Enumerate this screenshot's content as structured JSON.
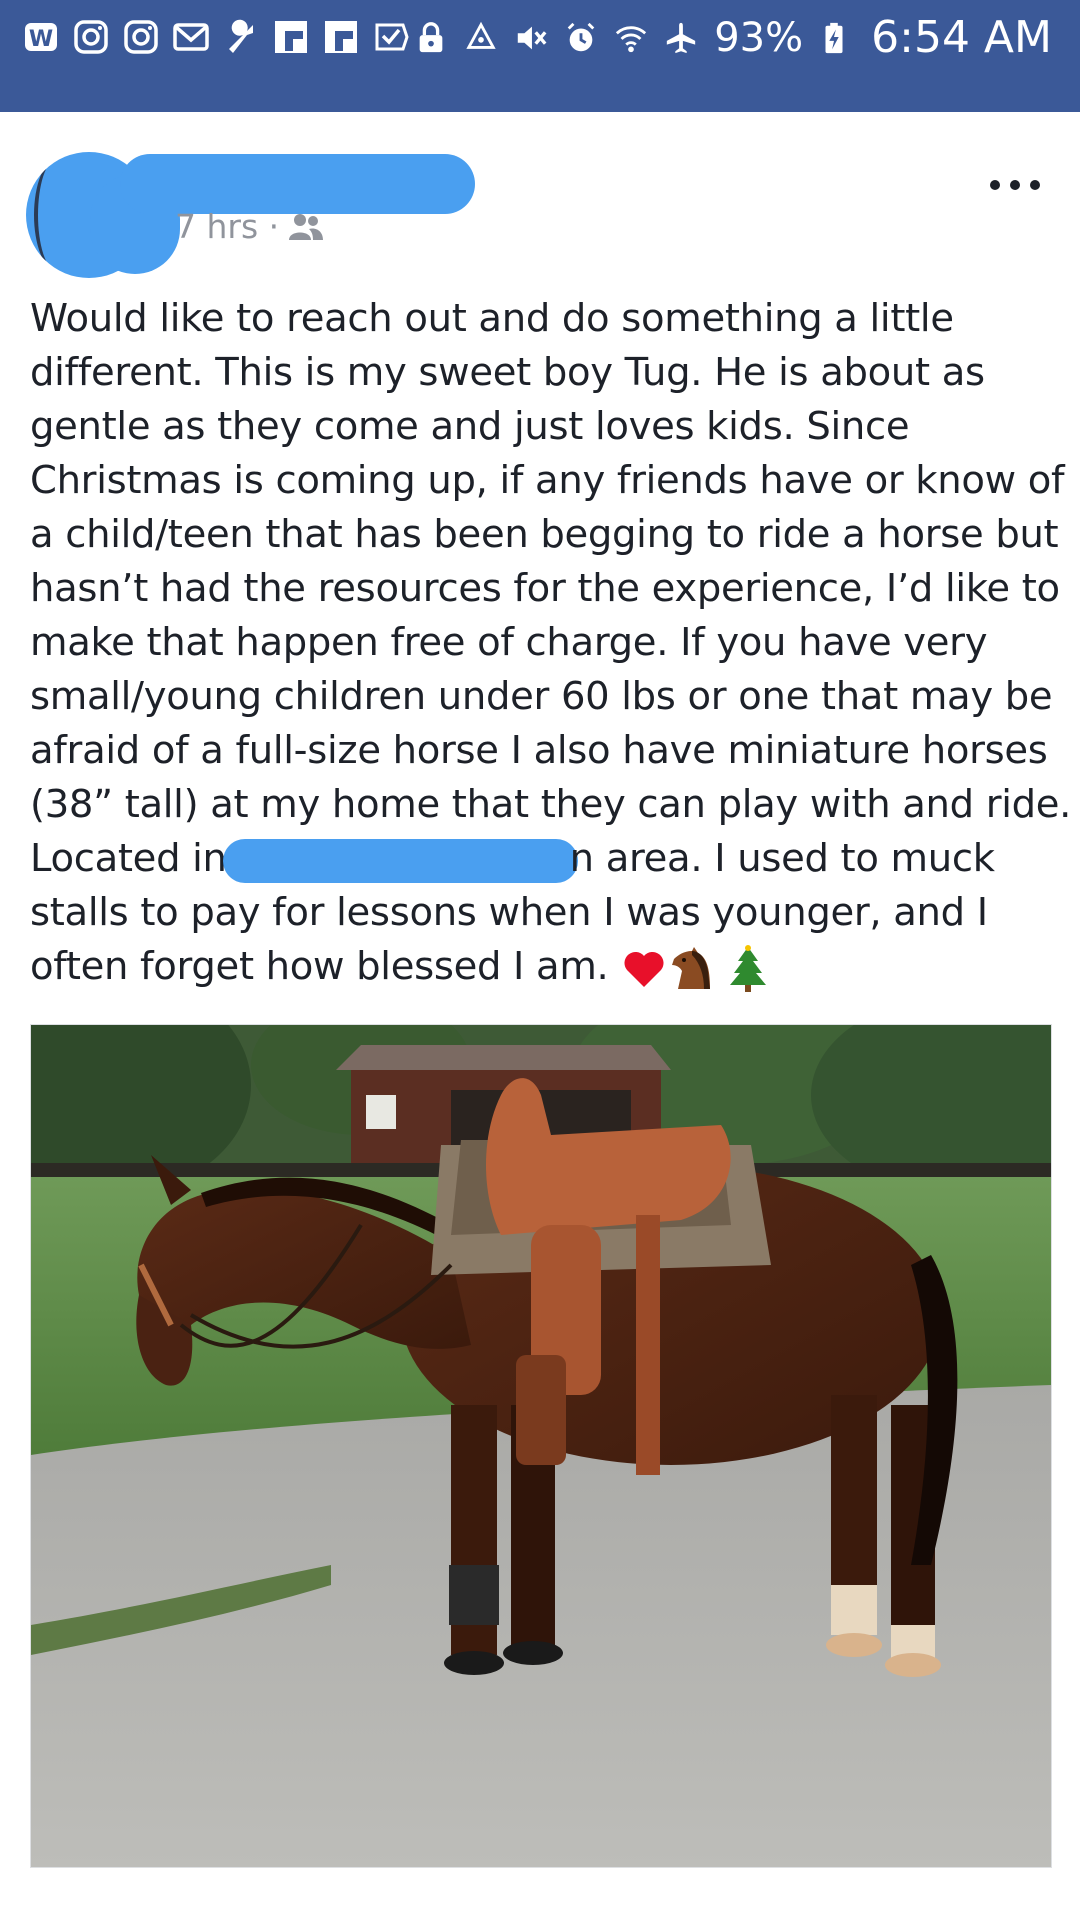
{
  "status_bar": {
    "left_icons": [
      "wordpress-icon",
      "instagram-icon",
      "instagram-icon",
      "gmail-icon",
      "wrench-icon",
      "flipboard-icon",
      "flipboard-icon",
      "checkbox-icon"
    ],
    "right_icons": [
      "lock-icon",
      "recycle-icon",
      "mute-icon",
      "alarm-icon",
      "wifi-icon",
      "airplane-icon"
    ],
    "battery": "93%",
    "time": "6:54 AM",
    "background_color": "#3b5998"
  },
  "post": {
    "timestamp": "7 hrs ·",
    "audience_icon": "friends-icon",
    "more_icon": "more-options-icon",
    "text_lines": [
      "Would like to reach out and do something a little",
      "different. This is my sweet boy Tug. He is about as",
      "gentle as they come and just loves kids. Since",
      "Christmas is coming up, if any friends have or know of",
      "a child/teen that has been begging to ride a horse but",
      "hasn’t had the resources for the experience, I’d like to",
      "make that happen free of charge. If you have very",
      "small/young children under 60 lbs or one that may be",
      "afraid of a full-size horse I also have miniature horses",
      "(38” tall) at my home that they can play with and ride."
    ],
    "line_located_before": "Located in",
    "line_located_after": "n area. I used to muck",
    "line_stalls": "stalls to pay for lessons when I was younger, and I",
    "line_last": "often forget how blessed I am.",
    "emojis": [
      "heart-emoji",
      "horse-emoji",
      "christmas-tree-emoji"
    ],
    "photo": {
      "name": "post-photo",
      "subject": "saddled bay horse on driveway"
    }
  }
}
